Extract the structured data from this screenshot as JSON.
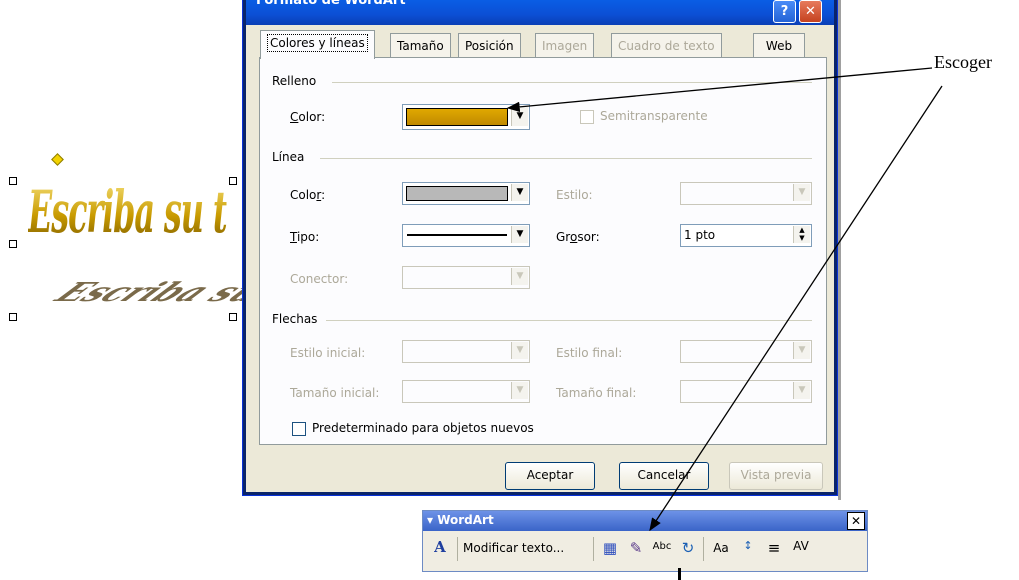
{
  "annotation": {
    "label": "Escoger"
  },
  "wordart_sample": {
    "text": "Escriba su t",
    "shadow_text": "Escriba su t"
  },
  "dialog": {
    "title": "Formato de WordArt",
    "help_glyph": "?",
    "close_glyph": "✕",
    "tabs": [
      {
        "label": "Colores y líneas",
        "active": true,
        "disabled": false
      },
      {
        "label": "Tamaño",
        "active": false,
        "disabled": false
      },
      {
        "label": "Posición",
        "active": false,
        "disabled": false
      },
      {
        "label": "Imagen",
        "active": false,
        "disabled": true
      },
      {
        "label": "Cuadro de texto",
        "active": false,
        "disabled": true
      },
      {
        "label": "Web",
        "active": false,
        "disabled": false
      }
    ],
    "relleno": {
      "group": "Relleno",
      "color_label": "Color:",
      "color_value": "#e0a800",
      "semitransparente": "Semitransparente"
    },
    "linea": {
      "group": "Línea",
      "color_label": "Color:",
      "color_value": "#b8b8b8",
      "estilo_label": "Estilo:",
      "tipo_label": "Tipo:",
      "grosor_label": "Grosor:",
      "grosor_value": "1 pto",
      "conector_label": "Conector:"
    },
    "flechas": {
      "group": "Flechas",
      "estilo_inicial": "Estilo inicial:",
      "estilo_final": "Estilo final:",
      "tamano_inicial": "Tamaño inicial:",
      "tamano_final": "Tamaño final:"
    },
    "predeterminado": "Predeterminado para objetos nuevos",
    "buttons": {
      "aceptar": "Aceptar",
      "cancelar": "Cancelar",
      "vista_previa": "Vista previa"
    }
  },
  "toolbar": {
    "title": "▾ WordArt",
    "close": "✕",
    "modificar_texto": "Modificar texto...",
    "icons": [
      "wordart-insert-icon",
      "gallery-icon",
      "format-wordart-icon",
      "shape-icon",
      "wrap-icon",
      "same-height-icon",
      "vertical-text-icon",
      "align-icon",
      "spacing-icon"
    ]
  },
  "colors": {
    "title_blue": "#0b4fd5",
    "dialog_face": "#ece9d8",
    "disabled_text": "#aca899",
    "gold": "#e0a800"
  }
}
